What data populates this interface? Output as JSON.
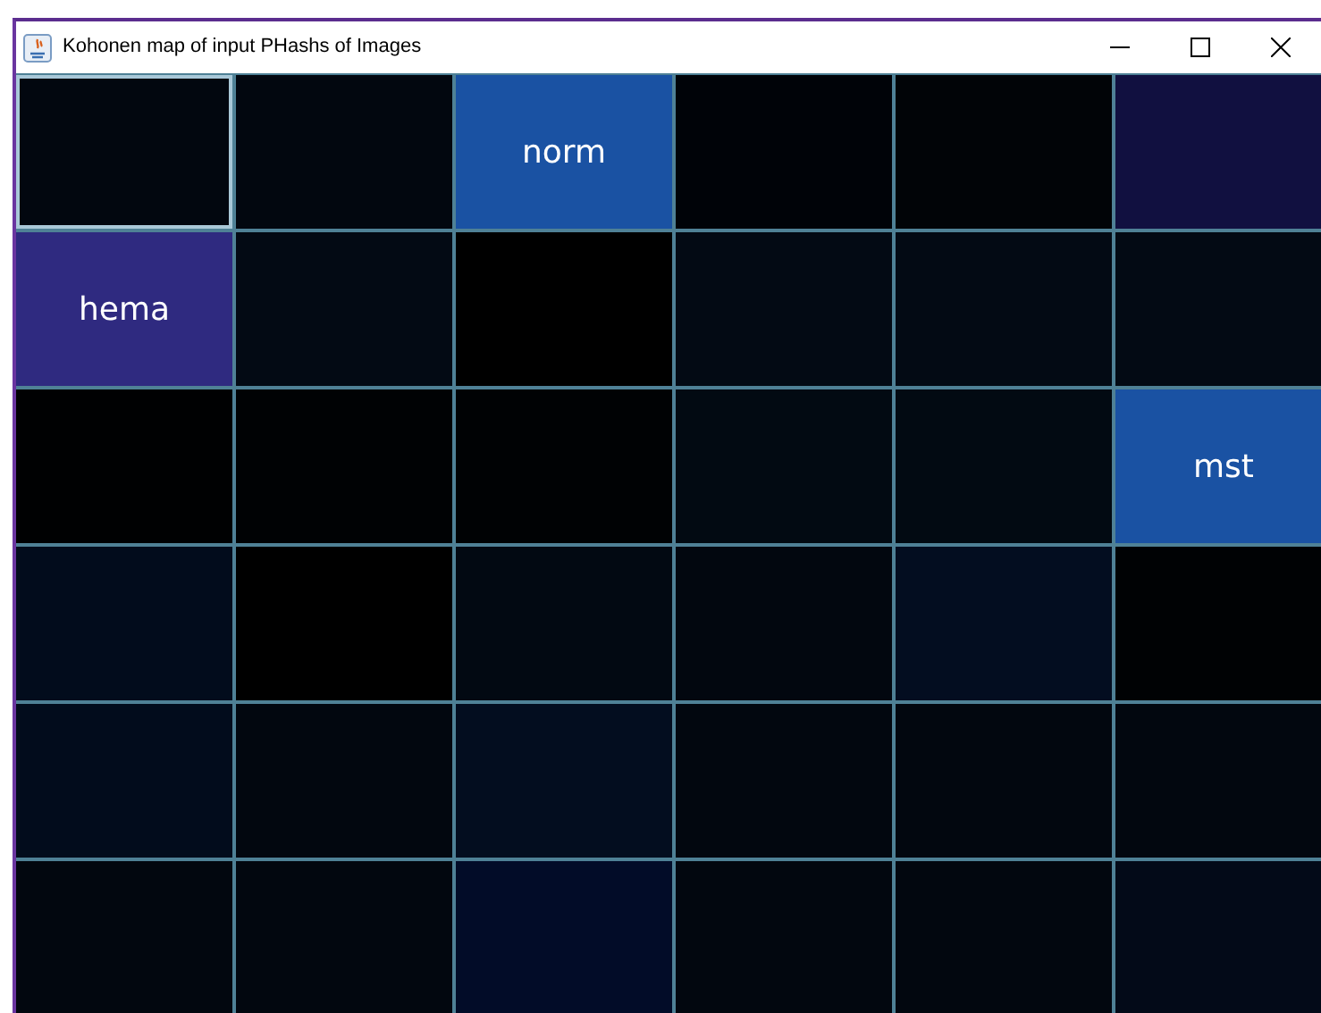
{
  "window": {
    "title": "Kohonen map of input PHashs of Images"
  },
  "map": {
    "rows": [
      [
        {
          "color": "#02070f",
          "selected": true
        },
        {
          "color": "#02070f",
          "selected": false
        },
        {
          "color": "#1a52a3",
          "label": "norm",
          "selected": false
        },
        {
          "color": "#000308",
          "selected": false
        },
        {
          "color": "#010407",
          "selected": false
        },
        {
          "color": "#111040",
          "selected": false
        }
      ],
      [
        {
          "color": "#2f2a80",
          "label": "hema",
          "selected": false
        },
        {
          "color": "#030a14",
          "selected": false
        },
        {
          "color": "#000000",
          "selected": false
        },
        {
          "color": "#030a14",
          "selected": false
        },
        {
          "color": "#030a14",
          "selected": false
        },
        {
          "color": "#030a14",
          "selected": false
        }
      ],
      [
        {
          "color": "#000102",
          "selected": false
        },
        {
          "color": "#000204",
          "selected": false
        },
        {
          "color": "#000204",
          "selected": false
        },
        {
          "color": "#020a12",
          "selected": false
        },
        {
          "color": "#020a12",
          "selected": false
        },
        {
          "color": "#1a52a3",
          "label": "mst",
          "selected": false
        }
      ],
      [
        {
          "color": "#020c1c",
          "selected": false
        },
        {
          "color": "#000000",
          "selected": false
        },
        {
          "color": "#020912",
          "selected": false
        },
        {
          "color": "#02070f",
          "selected": false
        },
        {
          "color": "#030d20",
          "selected": false
        },
        {
          "color": "#000204",
          "selected": false
        }
      ],
      [
        {
          "color": "#020c1c",
          "selected": false
        },
        {
          "color": "#02070f",
          "selected": false
        },
        {
          "color": "#030d1f",
          "selected": false
        },
        {
          "color": "#02070f",
          "selected": false
        },
        {
          "color": "#02070f",
          "selected": false
        },
        {
          "color": "#02070f",
          "selected": false
        }
      ],
      [
        {
          "color": "#02070f",
          "selected": false
        },
        {
          "color": "#02070f",
          "selected": false
        },
        {
          "color": "#020c28",
          "selected": false
        },
        {
          "color": "#02070f",
          "selected": false
        },
        {
          "color": "#02070f",
          "selected": false
        },
        {
          "color": "#030a18",
          "selected": false
        }
      ]
    ]
  }
}
